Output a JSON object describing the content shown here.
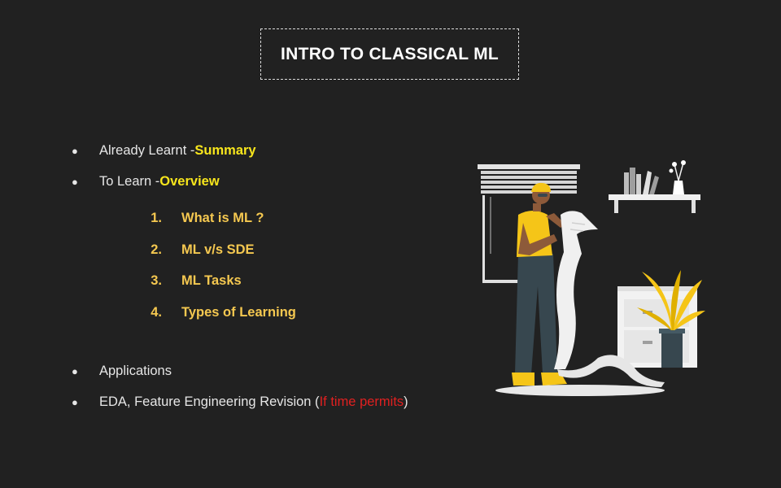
{
  "title": "INTRO TO CLASSICAL ML",
  "bullets_top": [
    {
      "text": "Already Learnt - ",
      "highlight": "Summary"
    },
    {
      "text": "To Learn - ",
      "highlight": "Overview"
    }
  ],
  "numbered": [
    {
      "num": "1.",
      "label": "What is ML ?"
    },
    {
      "num": "2.",
      "label": "ML  v/s SDE"
    },
    {
      "num": "3.",
      "label": "ML Tasks"
    },
    {
      "num": "4.",
      "label": "Types of Learning"
    }
  ],
  "bullets_bottom": [
    {
      "text": "Applications"
    },
    {
      "text": "EDA, Feature Engineering Revision (",
      "highlight": "If time permits",
      "suffix": ")"
    }
  ],
  "bullet_glyph": "●",
  "colors": {
    "background": "#212121",
    "highlight_yellow": "#f8e61c",
    "numbered_gold": "#f5c850",
    "highlight_red": "#e02020"
  },
  "illustration_icon": "person-reading-long-receipt-illustration"
}
